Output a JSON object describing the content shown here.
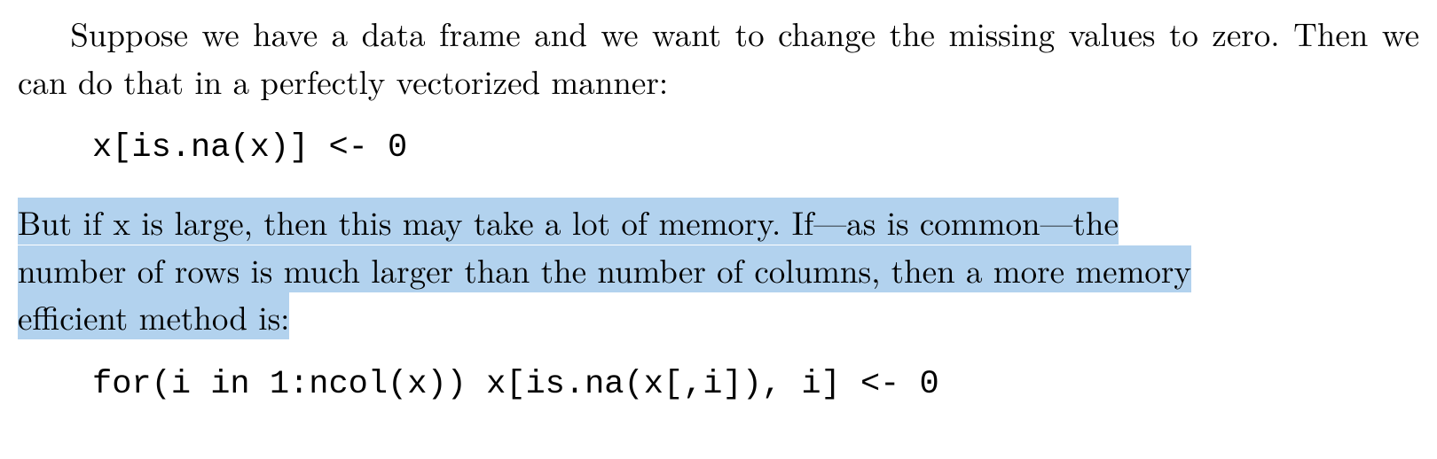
{
  "para1": {
    "text_a": "Suppose we have a data frame and we want to change the missing values to zero. Then we can do that in a perfectly vectorized manner:"
  },
  "code1": {
    "text": "x[is.na(x)] <- 0"
  },
  "para2": {
    "seg1": "But if x is large, then this may take a lot of memory.  If—as is common—the",
    "seg2": "number of rows is much larger than the number of columns, then a more memory",
    "seg3": "efficient method is:"
  },
  "code2": {
    "text": "for(i in 1:ncol(x)) x[is.na(x[,i]), i] <- 0"
  }
}
